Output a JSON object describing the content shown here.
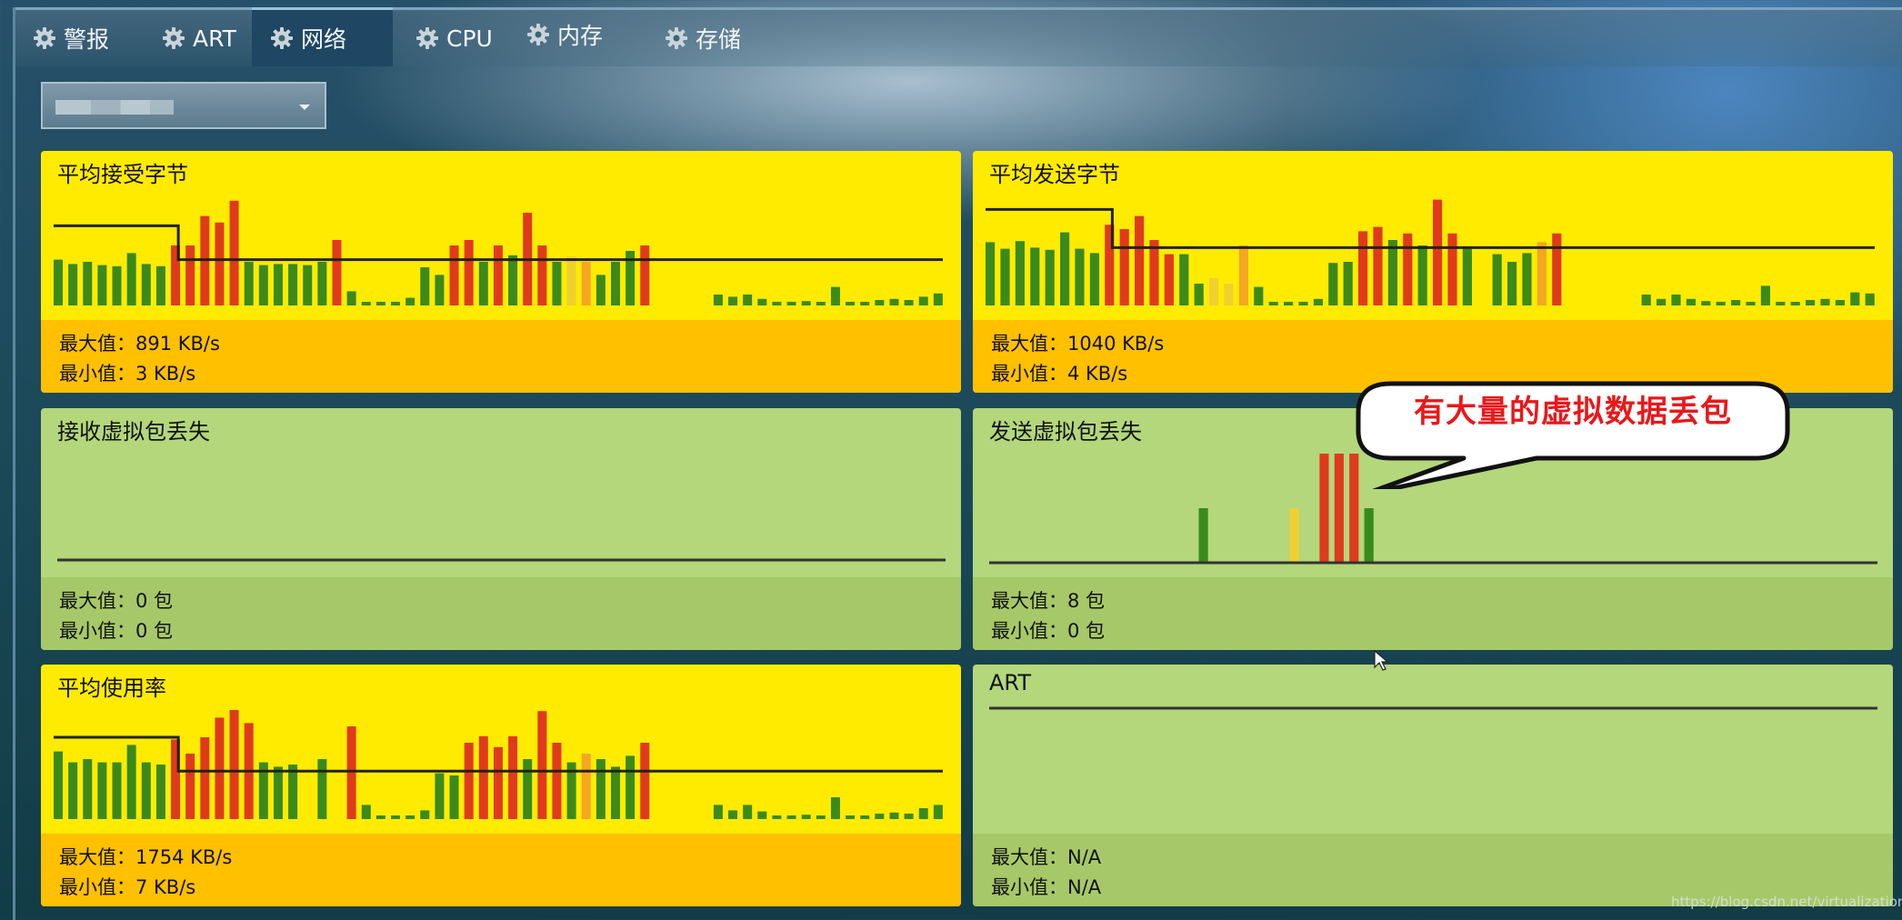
{
  "tabs": [
    {
      "label": "警报",
      "icon": "gear-icon"
    },
    {
      "label": "ART",
      "icon": "gear-icon"
    },
    {
      "label": "网络",
      "icon": "gear-icon",
      "active": true
    },
    {
      "label": "CPU",
      "icon": "gear-icon"
    },
    {
      "label": "内存",
      "icon": "gear-icon"
    },
    {
      "label": "存储",
      "icon": "gear-icon"
    }
  ],
  "colors": {
    "yellow": "#ffeb00",
    "orange": "#ffc000",
    "green_panel": "#b3d77a",
    "bar_green": "#3a8a1c",
    "bar_red": "#e03a1e",
    "bar_yellowish": "#f0d030",
    "bar_orange": "#f5a623"
  },
  "panels": {
    "recv_bytes": {
      "title": "平均接受字节",
      "max": "最大值：891 KB/s",
      "min": "最小值：3 KB/s"
    },
    "send_bytes": {
      "title": "平均发送字节",
      "max": "最大值：1040 KB/s",
      "min": "最小值：4 KB/s"
    },
    "recv_drop": {
      "title": "接收虚拟包丢失",
      "max": "最大值：0 包",
      "min": "最小值：0 包"
    },
    "send_drop": {
      "title": "发送虚拟包丢失",
      "max": "最大值：8 包",
      "min": "最小值：0 包"
    },
    "usage": {
      "title": "平均使用率",
      "max": "最大值：1754 KB/s",
      "min": "最小值：7 KB/s"
    },
    "art": {
      "title": "ART",
      "max": "最大值：N/A",
      "min": "最小值：N/A"
    }
  },
  "callout": "有大量的虚拟数据丢包",
  "watermark": "https://blog.csdn.net/virtualization_",
  "chart_data": [
    {
      "type": "bar",
      "name": "recv_bytes",
      "values": [
        0.42,
        0.38,
        0.4,
        0.37,
        0.36,
        0.48,
        0.38,
        0.36,
        0.55,
        0.55,
        0.82,
        0.76,
        0.96,
        0.4,
        0.37,
        0.38,
        0.38,
        0.37,
        0.4,
        0.6,
        0.13,
        0.03,
        0.03,
        0.03,
        0.07,
        0.35,
        0.28,
        0.55,
        0.6,
        0.4,
        0.55,
        0.46,
        0.85,
        0.55,
        0.4,
        0.45,
        0.4,
        0.28,
        0.4,
        0.5,
        0.55,
        0,
        0,
        0,
        0,
        0.1,
        0.08,
        0.1,
        0.06,
        0.03,
        0.03,
        0.04,
        0.03,
        0.17,
        0.03,
        0.03,
        0.05,
        0.06,
        0.05,
        0.08,
        0.11
      ],
      "colors": [
        "g",
        "g",
        "g",
        "g",
        "g",
        "g",
        "g",
        "g",
        "r",
        "r",
        "r",
        "r",
        "r",
        "g",
        "g",
        "g",
        "g",
        "g",
        "g",
        "r",
        "g",
        "g",
        "g",
        "g",
        "g",
        "g",
        "g",
        "r",
        "r",
        "g",
        "r",
        "g",
        "r",
        "r",
        "g",
        "y",
        "o",
        "g",
        "g",
        "g",
        "r",
        "n",
        "n",
        "n",
        "n",
        "g",
        "g",
        "g",
        "g",
        "g",
        "g",
        "g",
        "g",
        "g",
        "g",
        "g",
        "g",
        "g",
        "g",
        "g",
        "g"
      ],
      "threshold": [
        0.73,
        0.42
      ],
      "threshold_break": 8.5
    },
    {
      "type": "bar",
      "name": "send_bytes",
      "values": [
        0.58,
        0.52,
        0.59,
        0.53,
        0.51,
        0.67,
        0.52,
        0.48,
        0.74,
        0.7,
        0.82,
        0.6,
        0.47,
        0.47,
        0.2,
        0.25,
        0.2,
        0.55,
        0.17,
        0.03,
        0.03,
        0.03,
        0.06,
        0.39,
        0.4,
        0.68,
        0.72,
        0.6,
        0.66,
        0.55,
        0.97,
        0.66,
        0.52,
        0,
        0.47,
        0.4,
        0.48,
        0.58,
        0.66,
        0,
        0,
        0,
        0,
        0,
        0.1,
        0.06,
        0.1,
        0.06,
        0.04,
        0.03,
        0.05,
        0.03,
        0.18,
        0.03,
        0.03,
        0.05,
        0.06,
        0.05,
        0.12,
        0.11
      ],
      "colors": [
        "g",
        "g",
        "g",
        "g",
        "g",
        "g",
        "g",
        "g",
        "r",
        "r",
        "r",
        "r",
        "r",
        "g",
        "g",
        "y",
        "y",
        "o",
        "g",
        "g",
        "g",
        "g",
        "g",
        "g",
        "g",
        "r",
        "r",
        "g",
        "r",
        "g",
        "r",
        "r",
        "g",
        "n",
        "g",
        "g",
        "g",
        "o",
        "r",
        "n",
        "n",
        "n",
        "n",
        "n",
        "g",
        "g",
        "g",
        "g",
        "g",
        "g",
        "g",
        "g",
        "g",
        "g",
        "g",
        "g",
        "g",
        "g",
        "g",
        "g"
      ],
      "threshold": [
        0.88,
        0.53
      ],
      "threshold_break": 8.5
    },
    {
      "type": "bar",
      "name": "send_drop",
      "positions": [
        14.3,
        20.4,
        22.4,
        23.4,
        24.4,
        25.4
      ],
      "values": [
        0.5,
        0.5,
        1.0,
        1.0,
        1.0,
        0.5
      ],
      "colors": [
        "g",
        "y",
        "r",
        "r",
        "r",
        "g"
      ],
      "axis_extent": 60
    },
    {
      "type": "bar",
      "name": "usage",
      "values": [
        0.62,
        0.52,
        0.55,
        0.52,
        0.52,
        0.68,
        0.52,
        0.5,
        0.73,
        0.6,
        0.75,
        0.93,
        1.0,
        0.88,
        0.52,
        0.48,
        0.5,
        0,
        0.55,
        0,
        0.85,
        0.13,
        0.03,
        0.03,
        0.03,
        0.08,
        0.42,
        0.4,
        0.7,
        0.76,
        0.66,
        0.76,
        0.55,
        0.99,
        0.7,
        0.52,
        0.6,
        0.55,
        0.48,
        0.58,
        0.7,
        0,
        0,
        0,
        0,
        0.13,
        0.08,
        0.13,
        0.07,
        0.03,
        0.03,
        0.04,
        0.03,
        0.2,
        0.03,
        0.03,
        0.05,
        0.06,
        0.05,
        0.1,
        0.13
      ],
      "colors": [
        "g",
        "g",
        "g",
        "g",
        "g",
        "g",
        "g",
        "g",
        "r",
        "r",
        "r",
        "r",
        "r",
        "r",
        "g",
        "g",
        "g",
        "n",
        "g",
        "n",
        "r",
        "g",
        "g",
        "g",
        "g",
        "g",
        "g",
        "g",
        "r",
        "r",
        "r",
        "r",
        "g",
        "r",
        "r",
        "g",
        "o",
        "g",
        "g",
        "g",
        "r",
        "n",
        "n",
        "n",
        "n",
        "g",
        "g",
        "g",
        "g",
        "g",
        "g",
        "g",
        "g",
        "g",
        "g",
        "g",
        "g",
        "g",
        "g",
        "g",
        "g"
      ],
      "threshold": [
        0.75,
        0.44
      ],
      "threshold_break": 8.5
    }
  ]
}
